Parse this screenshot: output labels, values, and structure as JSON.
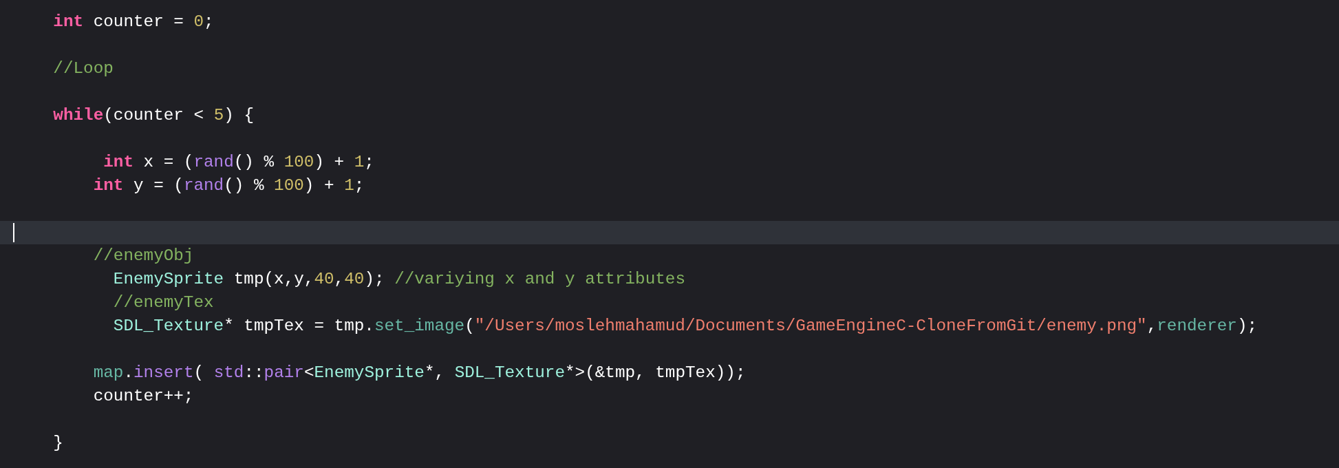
{
  "editor": {
    "lines": [
      {
        "kind": "code",
        "tokens": [
          {
            "kind": "keyword",
            "text": "    int"
          },
          {
            "kind": "plain",
            "text": " counter = "
          },
          {
            "kind": "number",
            "text": "0"
          },
          {
            "kind": "plain",
            "text": ";"
          }
        ]
      },
      {
        "kind": "blank"
      },
      {
        "kind": "code",
        "tokens": [
          {
            "kind": "comment",
            "text": "    //Loop"
          }
        ]
      },
      {
        "kind": "blank"
      },
      {
        "kind": "code",
        "tokens": [
          {
            "kind": "keyword",
            "text": "    while"
          },
          {
            "kind": "plain",
            "text": "(counter < "
          },
          {
            "kind": "number",
            "text": "5"
          },
          {
            "kind": "plain",
            "text": ") {"
          }
        ]
      },
      {
        "kind": "blank"
      },
      {
        "kind": "code",
        "tokens": [
          {
            "kind": "keyword",
            "text": "         int"
          },
          {
            "kind": "plain",
            "text": " x = ("
          },
          {
            "kind": "system",
            "text": "rand"
          },
          {
            "kind": "plain",
            "text": "() % "
          },
          {
            "kind": "number",
            "text": "100"
          },
          {
            "kind": "plain",
            "text": ") + "
          },
          {
            "kind": "number",
            "text": "1"
          },
          {
            "kind": "plain",
            "text": ";"
          }
        ]
      },
      {
        "kind": "code",
        "tokens": [
          {
            "kind": "keyword",
            "text": "        int"
          },
          {
            "kind": "plain",
            "text": " y = ("
          },
          {
            "kind": "system",
            "text": "rand"
          },
          {
            "kind": "plain",
            "text": "() % "
          },
          {
            "kind": "number",
            "text": "100"
          },
          {
            "kind": "plain",
            "text": ") + "
          },
          {
            "kind": "number",
            "text": "1"
          },
          {
            "kind": "plain",
            "text": ";"
          }
        ]
      },
      {
        "kind": "blank"
      },
      {
        "kind": "cursor"
      },
      {
        "kind": "code",
        "tokens": [
          {
            "kind": "comment",
            "text": "        //enemyObj"
          }
        ]
      },
      {
        "kind": "code",
        "tokens": [
          {
            "kind": "type",
            "text": "          EnemySprite"
          },
          {
            "kind": "plain",
            "text": " tmp(x,y,"
          },
          {
            "kind": "number",
            "text": "40"
          },
          {
            "kind": "plain",
            "text": ","
          },
          {
            "kind": "number",
            "text": "40"
          },
          {
            "kind": "plain",
            "text": "); "
          },
          {
            "kind": "comment",
            "text": "//variying x and y attributes"
          }
        ]
      },
      {
        "kind": "code",
        "tokens": [
          {
            "kind": "comment",
            "text": "          //enemyTex"
          }
        ]
      },
      {
        "kind": "code",
        "tokens": [
          {
            "kind": "type",
            "text": "          SDL_Texture"
          },
          {
            "kind": "plain",
            "text": "* tmpTex = tmp."
          },
          {
            "kind": "project",
            "text": "set_image"
          },
          {
            "kind": "plain",
            "text": "("
          },
          {
            "kind": "string",
            "text": "\"/Users/moslehmahamud/Documents/GameEngineC-CloneFromGit/enemy.png\""
          },
          {
            "kind": "plain",
            "text": ","
          },
          {
            "kind": "project",
            "text": "renderer"
          },
          {
            "kind": "plain",
            "text": ");"
          }
        ]
      },
      {
        "kind": "blank"
      },
      {
        "kind": "code",
        "tokens": [
          {
            "kind": "project",
            "text": "        map"
          },
          {
            "kind": "plain",
            "text": "."
          },
          {
            "kind": "system",
            "text": "insert"
          },
          {
            "kind": "plain",
            "text": "( "
          },
          {
            "kind": "system",
            "text": "std"
          },
          {
            "kind": "plain",
            "text": "::"
          },
          {
            "kind": "system",
            "text": "pair"
          },
          {
            "kind": "plain",
            "text": "<"
          },
          {
            "kind": "type",
            "text": "EnemySprite"
          },
          {
            "kind": "plain",
            "text": "*, "
          },
          {
            "kind": "type",
            "text": "SDL_Texture"
          },
          {
            "kind": "plain",
            "text": "*>(&tmp, tmpTex));"
          }
        ]
      },
      {
        "kind": "code",
        "tokens": [
          {
            "kind": "plain",
            "text": "        counter++;"
          }
        ]
      },
      {
        "kind": "blank"
      },
      {
        "kind": "code",
        "tokens": [
          {
            "kind": "plain",
            "text": "    }"
          }
        ]
      }
    ]
  }
}
